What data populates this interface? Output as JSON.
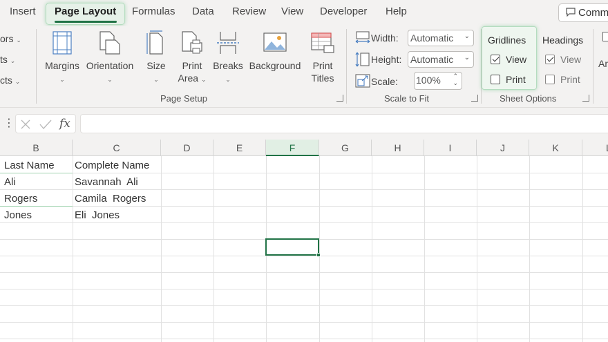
{
  "tabs": {
    "insert": "Insert",
    "page_layout": "Page Layout",
    "formulas": "Formulas",
    "data": "Data",
    "review": "Review",
    "view": "View",
    "developer": "Developer",
    "help": "Help",
    "comments": "Comm"
  },
  "ribbon": {
    "left_partial": [
      "ors",
      "ts",
      "cts"
    ],
    "page_setup": {
      "margins": "Margins",
      "orientation": "Orientation",
      "size": "Size",
      "print_area_1": "Print",
      "print_area_2": "Area",
      "breaks": "Breaks",
      "background": "Background",
      "print_titles_1": "Print",
      "print_titles_2": "Titles",
      "group_label": "Page Setup"
    },
    "scale_to_fit": {
      "width_label": "Width:",
      "width_value": "Automatic",
      "height_label": "Height:",
      "height_value": "Automatic",
      "scale_label": "Scale:",
      "scale_value": "100%",
      "group_label": "Scale to Fit"
    },
    "sheet_options": {
      "gridlines_head": "Gridlines",
      "gridlines_view": "View",
      "gridlines_print": "Print",
      "gridlines_view_checked": true,
      "gridlines_print_checked": false,
      "headings_head": "Headings",
      "headings_view": "View",
      "headings_print": "Print",
      "headings_view_checked": true,
      "headings_print_checked": false,
      "group_label": "Sheet Options"
    },
    "right_partial": "Ar"
  },
  "formula_bar": {
    "fx": "fx",
    "value": ""
  },
  "columns": [
    "B",
    "C",
    "D",
    "E",
    "F",
    "G",
    "H",
    "I",
    "J",
    "K",
    "L"
  ],
  "selected_column": "F",
  "cells": {
    "b1": "Last Name",
    "c1": "Complete Name",
    "b2": "Ali",
    "c2": "Savannah  Ali",
    "b3": "Rogers",
    "c3": "Camila  Rogers",
    "b4": "Jones",
    "c4": "Eli  Jones"
  },
  "colors": {
    "accent": "#217346",
    "ribbon_bg": "#f3f2f1"
  }
}
